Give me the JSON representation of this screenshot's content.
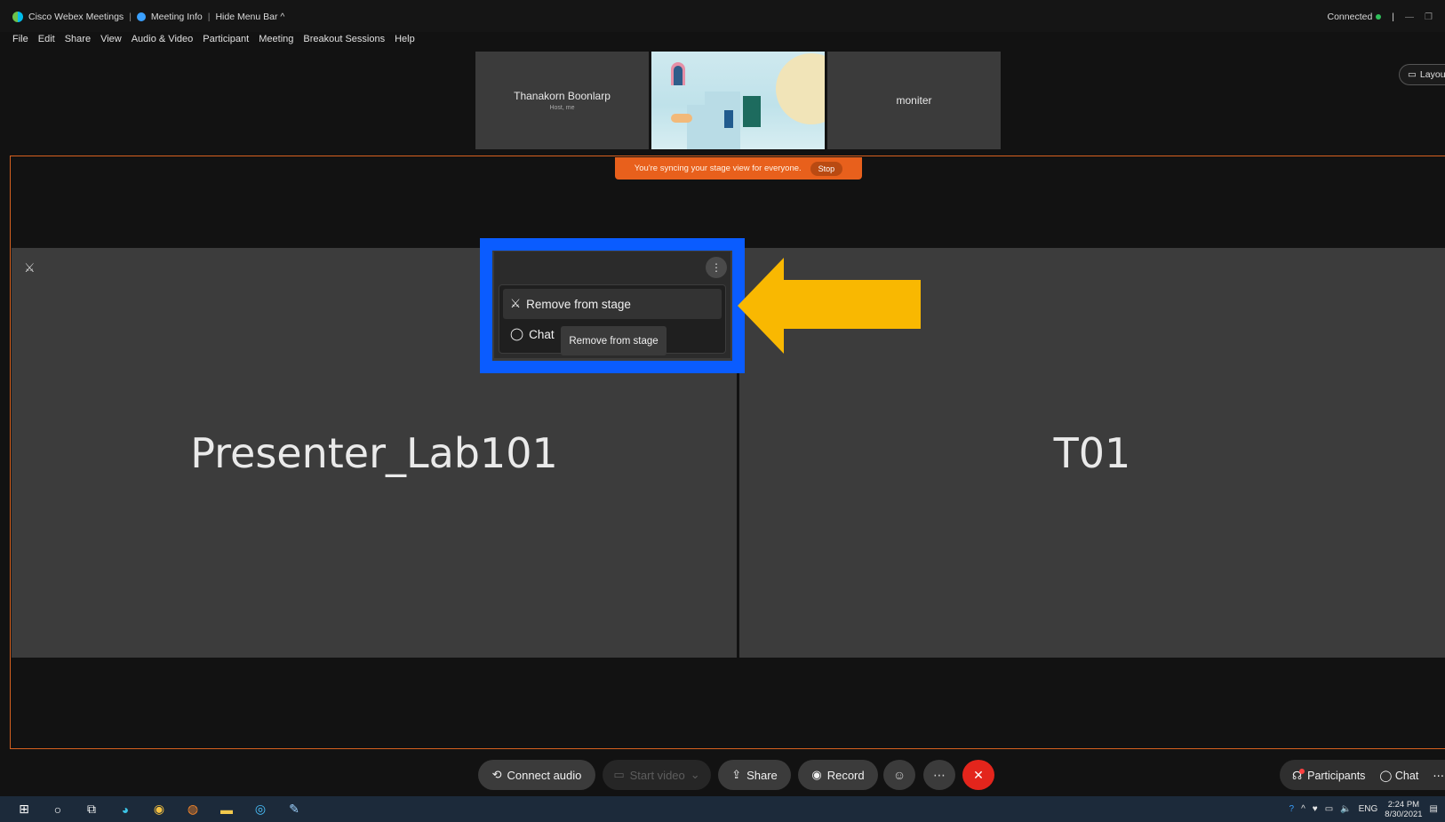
{
  "titlebar": {
    "app_title": "Cisco Webex Meetings",
    "meeting_info": "Meeting Info",
    "hide_menu_bar": "Hide Menu Bar ^",
    "status": "Connected",
    "separator": "|"
  },
  "menu": [
    "File",
    "Edit",
    "Share",
    "View",
    "Audio & Video",
    "Participant",
    "Meeting",
    "Breakout Sessions",
    "Help"
  ],
  "thumbnails": {
    "host_name": "Thanakorn Boonlarp",
    "host_sub": "Host, me",
    "third_name": "moniter"
  },
  "layout_button": "Layout",
  "sync_banner": {
    "text": "You're syncing your stage view for everyone.",
    "stop_label": "Stop"
  },
  "stage": {
    "left_tile": "Presenter_Lab101",
    "right_tile": "T01"
  },
  "context_menu": {
    "more_icon": "⋮",
    "items": [
      "Remove from stage",
      "Chat"
    ],
    "tooltip": "Remove from stage"
  },
  "controls": {
    "connect_audio": "Connect audio",
    "start_video": "Start video",
    "share": "Share",
    "record": "Record",
    "participants": "Participants",
    "chat": "Chat"
  },
  "taskbar": {
    "language": "ENG",
    "time": "2:24 PM",
    "date": "8/30/2021"
  },
  "colors": {
    "accent_orange": "#e8601c",
    "highlight_blue": "#0a5cff",
    "arrow_yellow": "#f9b801",
    "end_red": "#e3251c"
  }
}
